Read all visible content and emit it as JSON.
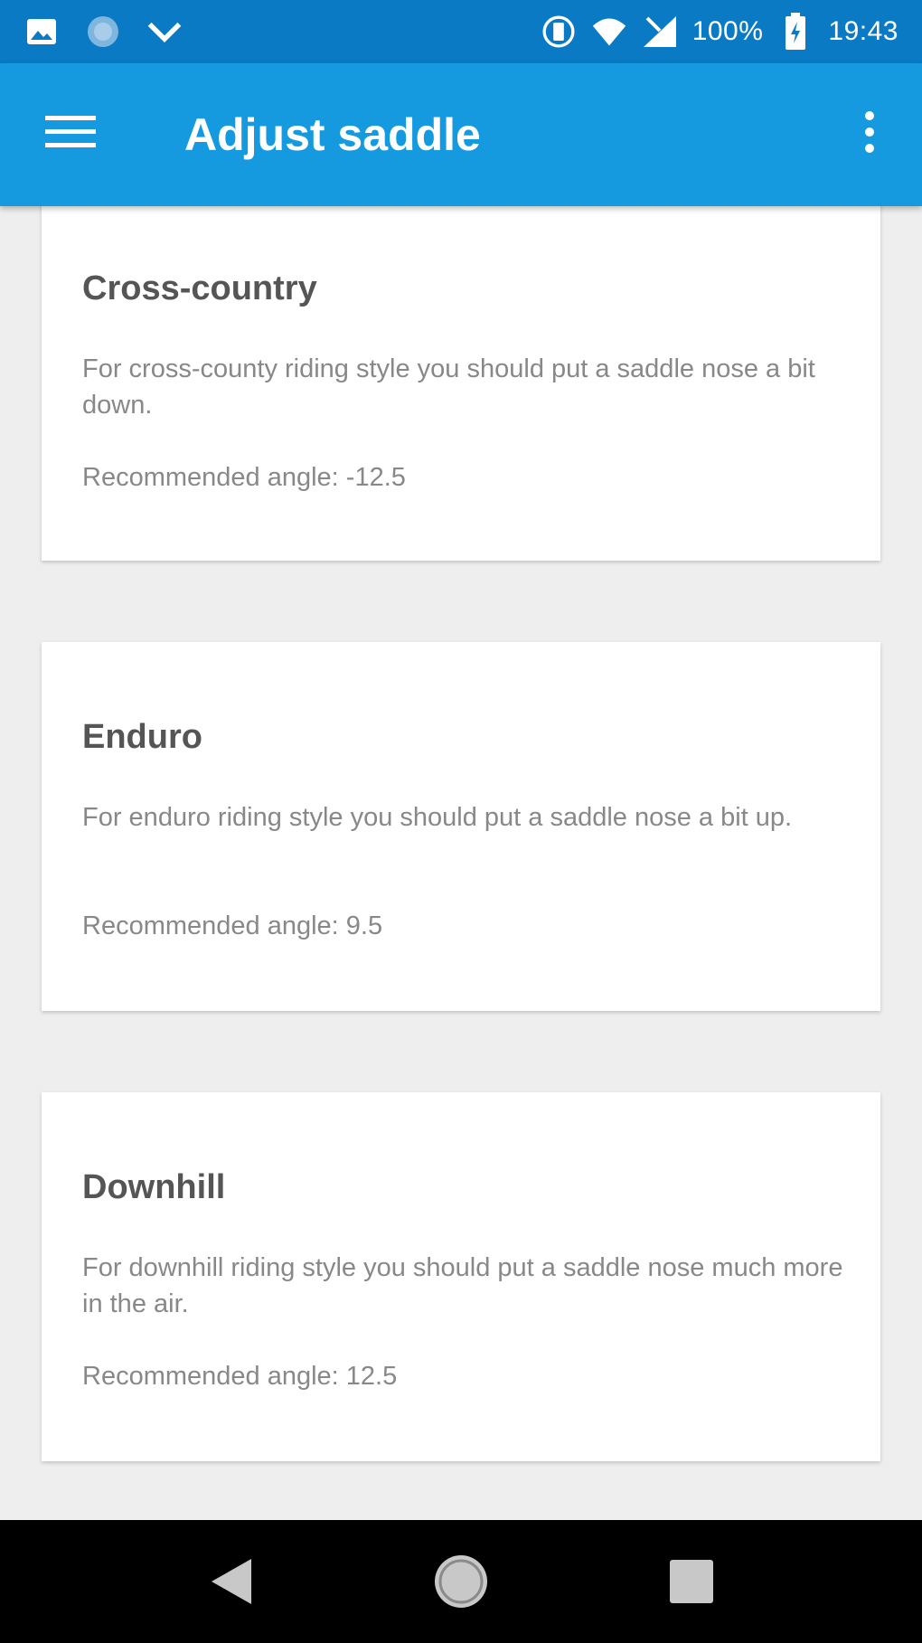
{
  "status_bar": {
    "battery": "100%",
    "time": "19:43",
    "icons": [
      "image-icon",
      "circle-icon",
      "chevron-down-icon",
      "vibrate-icon",
      "wifi-icon",
      "signal-icon",
      "battery-charging-icon"
    ]
  },
  "app_bar": {
    "title": "Adjust saddle",
    "menu_icon": "hamburger-menu-icon",
    "overflow_icon": "more-vert-icon",
    "color": "#159ae0"
  },
  "cards": [
    {
      "title": "Cross-country",
      "description": "For cross-county riding style you should put a saddle nose a bit down.",
      "angle": "Recommended angle: -12.5"
    },
    {
      "title": "Enduro",
      "description": "For enduro riding style you should put a saddle nose a bit up.",
      "angle": "Recommended angle: 9.5"
    },
    {
      "title": "Downhill",
      "description": "For downhill riding style you should put a saddle nose much more in the air.",
      "angle": "Recommended angle: 12.5"
    }
  ],
  "nav_bar": {
    "buttons": [
      "back-icon",
      "home-icon",
      "recents-icon"
    ]
  }
}
